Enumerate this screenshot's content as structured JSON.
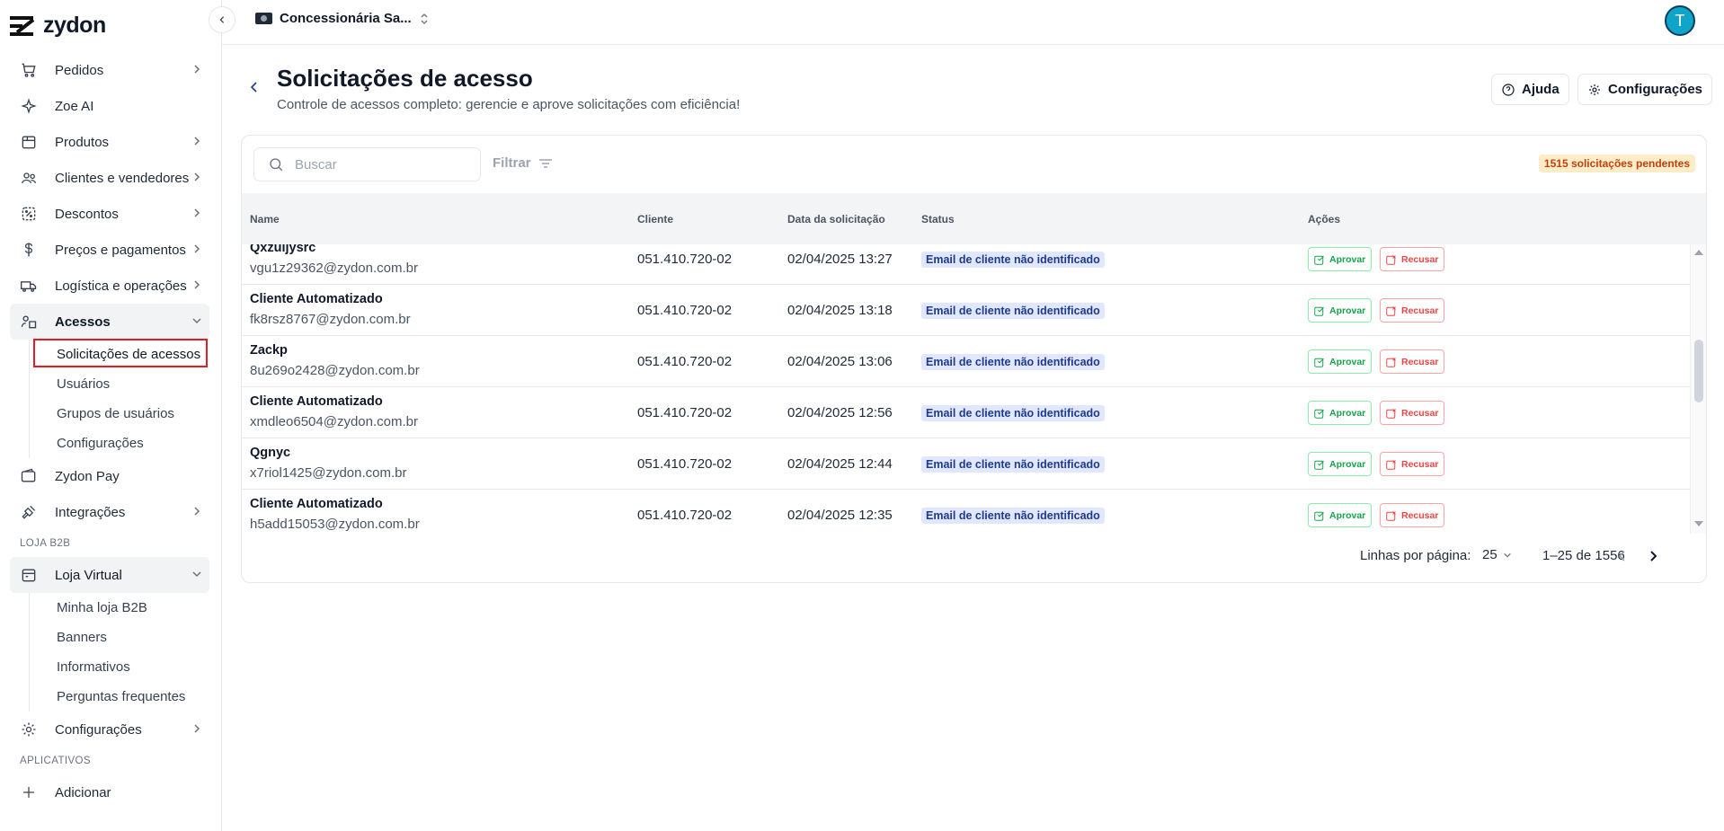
{
  "brand": {
    "name": "zydon"
  },
  "topbar": {
    "store_name": "Concessionária Sa...",
    "avatar_initial": "T"
  },
  "sidebar": {
    "items": [
      {
        "label": "Pedidos"
      },
      {
        "label": "Zoe AI"
      },
      {
        "label": "Produtos"
      },
      {
        "label": "Clientes e vendedores"
      },
      {
        "label": "Descontos"
      },
      {
        "label": "Preços e pagamentos"
      },
      {
        "label": "Logística e operações"
      },
      {
        "label": "Acessos"
      },
      {
        "label": "Zydon Pay"
      },
      {
        "label": "Integrações"
      },
      {
        "label": "Loja Virtual"
      },
      {
        "label": "Configurações"
      },
      {
        "label": "Adicionar"
      }
    ],
    "acessos_sub": [
      "Solicitações de acessos",
      "Usuários",
      "Grupos de usuários",
      "Configurações"
    ],
    "loja_sub": [
      "Minha loja B2B",
      "Banners",
      "Informativos",
      "Perguntas frequentes"
    ],
    "section_b2b": "LOJA B2B",
    "section_apps": "APLICATIVOS"
  },
  "page": {
    "title": "Solicitações de acesso",
    "subtitle": "Controle de acessos completo: gerencie e aprove solicitações com eficiência!",
    "help_label": "Ajuda",
    "config_label": "Configurações"
  },
  "toolbar": {
    "search_placeholder": "Buscar",
    "filter_label": "Filtrar",
    "pending_badge": "1515 solicitações pendentes"
  },
  "table": {
    "headers": {
      "name": "Name",
      "client": "Cliente",
      "date": "Data da solicitação",
      "status": "Status",
      "actions": "Ações"
    },
    "approve_label": "Aprovar",
    "reject_label": "Recusar",
    "rows": [
      {
        "name": "Qxzuijysrc",
        "email": "vgu1z29362@zydon.com.br",
        "client": "051.410.720-02",
        "date": "02/04/2025 13:27",
        "status": "Email de cliente não identificado"
      },
      {
        "name": "Cliente Automatizado",
        "email": "fk8rsz8767@zydon.com.br",
        "client": "051.410.720-02",
        "date": "02/04/2025 13:18",
        "status": "Email de cliente não identificado"
      },
      {
        "name": "Zackp",
        "email": "8u269o2428@zydon.com.br",
        "client": "051.410.720-02",
        "date": "02/04/2025 13:06",
        "status": "Email de cliente não identificado"
      },
      {
        "name": "Cliente Automatizado",
        "email": "xmdleo6504@zydon.com.br",
        "client": "051.410.720-02",
        "date": "02/04/2025 12:56",
        "status": "Email de cliente não identificado"
      },
      {
        "name": "Qgnyc",
        "email": "x7riol1425@zydon.com.br",
        "client": "051.410.720-02",
        "date": "02/04/2025 12:44",
        "status": "Email de cliente não identificado"
      },
      {
        "name": "Cliente Automatizado",
        "email": "h5add15053@zydon.com.br",
        "client": "051.410.720-02",
        "date": "02/04/2025 12:35",
        "status": "Email de cliente não identificado"
      }
    ]
  },
  "pagination": {
    "rows_per_page_label": "Linhas por página:",
    "rows_per_page": "25",
    "range": "1–25 de 1556"
  }
}
